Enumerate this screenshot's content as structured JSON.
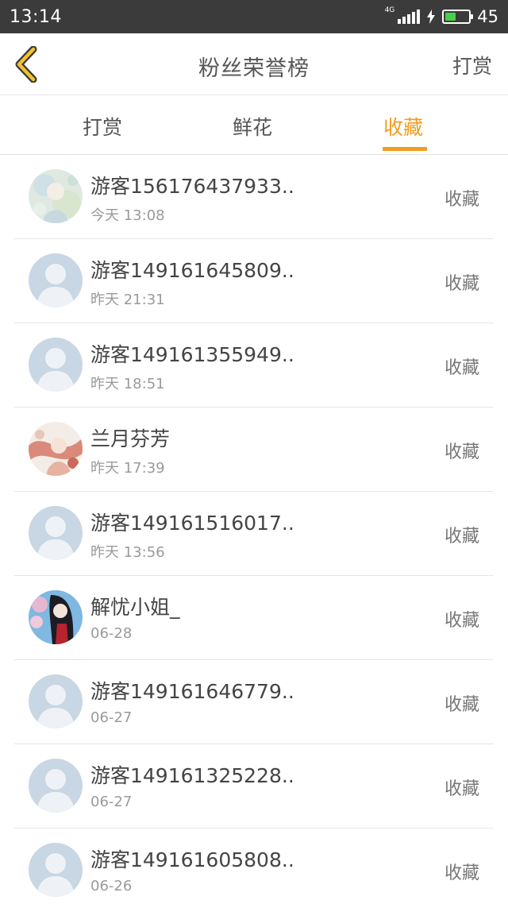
{
  "status_bar": {
    "time": "13:14",
    "network": "4G",
    "battery_percent": "45",
    "battery_level": 0.45,
    "charging": true
  },
  "header": {
    "title": "粉丝荣誉榜",
    "action": "打赏",
    "back_icon": "chevron-left-icon"
  },
  "tabs": [
    {
      "label": "打赏",
      "active": false
    },
    {
      "label": "鲜花",
      "active": false
    },
    {
      "label": "收藏",
      "active": true
    }
  ],
  "colors": {
    "accent": "#f29c1f",
    "status_bar": "#3b3b3b",
    "divider": "#e6e6e6"
  },
  "rows": [
    {
      "name": "游客156176437933..",
      "time": "今天 13:08",
      "action": "收藏",
      "avatar": "anime-avatar-pale"
    },
    {
      "name": "游客149161645809..",
      "time": "昨天 21:31",
      "action": "收藏",
      "avatar": "default-user-avatar"
    },
    {
      "name": "游客149161355949..",
      "time": "昨天 18:51",
      "action": "收藏",
      "avatar": "default-user-avatar"
    },
    {
      "name": "兰月芬芳",
      "time": "昨天 17:39",
      "action": "收藏",
      "avatar": "anime-avatar-red"
    },
    {
      "name": "游客149161516017..",
      "time": "昨天 13:56",
      "action": "收藏",
      "avatar": "default-user-avatar"
    },
    {
      "name": "解忧小姐_",
      "time": "06-28",
      "action": "收藏",
      "avatar": "anime-avatar-dark"
    },
    {
      "name": "游客149161646779..",
      "time": "06-27",
      "action": "收藏",
      "avatar": "default-user-avatar"
    },
    {
      "name": "游客149161325228..",
      "time": "06-27",
      "action": "收藏",
      "avatar": "default-user-avatar"
    },
    {
      "name": "游客149161605808..",
      "time": "06-26",
      "action": "收藏",
      "avatar": "default-user-avatar"
    }
  ]
}
